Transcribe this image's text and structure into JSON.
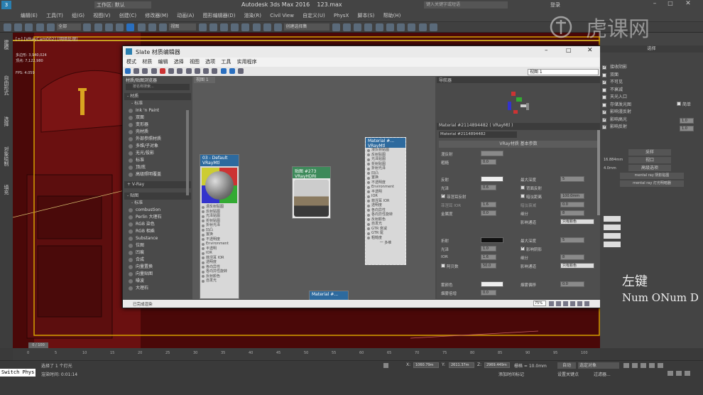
{
  "titlebar": {
    "workspace": "工作区: 默认",
    "app": "Autodesk 3ds Max 2016",
    "file": "123.max",
    "search_placeholder": "键入关键字或短语",
    "login": "登录"
  },
  "menu": [
    "编辑(E)",
    "工具(T)",
    "组(G)",
    "视图(V)",
    "创建(C)",
    "修改器(M)",
    "动画(A)",
    "图形编辑器(D)",
    "渲染(R)",
    "Civil View",
    "自定义(U)",
    "PhysX",
    "脚本(S)",
    "帮助(H)"
  ],
  "toolbar": {
    "filter": "全部",
    "view": "视图",
    "selset": "创建选择集"
  },
  "viewport": {
    "label": "[+] [VRayCam002] [明暗处理]",
    "stats": [
      "多边形: 3,940,024",
      "顶点: 7,122,980"
    ],
    "fps_label": "FPS:",
    "fps": "4.059"
  },
  "leftstrip": [
    "建模",
    "自由形式",
    "选择",
    "对象绘制",
    "填充"
  ],
  "slate": {
    "title": "Slate 材质编辑器",
    "menu": [
      "模式",
      "材质",
      "编辑",
      "选择",
      "视图",
      "选项",
      "工具",
      "实用程序"
    ],
    "view_select": "视图 1",
    "browser_title": "材质/贴图浏览器",
    "search_placeholder": "按名称搜索...",
    "sec_materials": "- 材质",
    "sub_standard": "- 标准",
    "materials": [
      "Ink 'n Paint",
      "双面",
      "变形器",
      "壳材质",
      "外部参照材质",
      "多维/子对象",
      "无光/投影",
      "标准",
      "顶/底",
      "高级照明覆盖"
    ],
    "sec_vray": "+ V-Ray",
    "sec_maps": "- 贴图",
    "sub_maps": "- 标准",
    "maps": [
      "combustion",
      "Perlin 大理石",
      "RGB 染色",
      "RGB 相乘",
      "Substance",
      "位图",
      "凹痕",
      "合成",
      "向量置换",
      "向量贴图",
      "噪波",
      "大理石"
    ],
    "view_tab": "视图 1",
    "status_left": "已完成渲染",
    "zoom": "75%",
    "navigator": "导航器",
    "node_std": {
      "title": "03 - Default",
      "type": "VRayMtl",
      "slots": [
        "漫反射贴图",
        "反射贴图",
        "光泽贴图",
        "折射贴图",
        "折射光泽",
        "凹凸",
        "置换",
        "不透明度",
        "Environment",
        "半透明",
        "IOR",
        "菲涅耳 IOR",
        "透明度",
        "各向异性",
        "各向异性旋转",
        "反射颜色",
        "自发光"
      ]
    },
    "node_bmp": {
      "title": "贴图 #273",
      "type": "VRayHDRI"
    },
    "node_right": {
      "title": "Material #...",
      "type": "VRayMtl",
      "slots": [
        "漫反射贴图",
        "反射贴图",
        "光泽贴图",
        "折射贴图",
        "折射光泽",
        "凹凸",
        "置换",
        "不透明度",
        "Environment",
        "半透明",
        "IOR",
        "菲涅耳 IOR",
        "透明度",
        "各向异性",
        "各向异性旋转",
        "反射颜色",
        "自发光",
        "GTR 衰减",
        "GTR 尾",
        "粗糙度"
      ],
      "footer": "一 多维"
    },
    "node_bottom": {
      "title": "Material #..."
    },
    "prop_header": "Material #2114894482 ( VRayMtl )",
    "prop_name": "Material #2114894482",
    "prop_rollout": "VRay材质 基本参数",
    "props": {
      "diffuse": "漫反射",
      "roughness": "粗糙",
      "roughness_val": "0.0",
      "reflect": "反射",
      "gloss": "光泽",
      "gloss_val": "0.6",
      "fresnel": "菲涅耳反射",
      "fresnel_ior": "菲涅耳 IOR",
      "fresnel_ior_val": "1.6",
      "metal": "金属度",
      "metal_val": "0.0",
      "maxdepth": "最大深度",
      "maxdepth_val": "5",
      "backside": "背面反射",
      "dim_dist": "暗淡距离",
      "dim_val": "100.0mm",
      "dim_falloff": "暗淡衰减",
      "dim_falloff_val": "0.0",
      "subdiv": "细分",
      "subdiv_val": "8",
      "affect": "影响通道",
      "affect_val": "只有颜色",
      "refract": "折射",
      "rgloss": "光泽",
      "rgloss_val": "1.0",
      "rior": "IOR",
      "rior_val": "1.6",
      "abbe": "阿贝数",
      "abbe_val": "50.0",
      "rmaxdepth": "最大深度",
      "rmaxdepth_val": "5",
      "affect_shadow": "影响阴影",
      "rsubdiv": "细分",
      "rsubdiv_val": "8",
      "raffect": "影响通道",
      "raffect_val": "只有颜色",
      "fog": "雾颜色",
      "fog_bias": "烟雾偏移",
      "fog_bias_val": "0.0",
      "fog_mult": "烟雾倍增",
      "fog_mult_val": "0.0"
    }
  },
  "rightpanel": {
    "header": "选择",
    "items": [
      {
        "label": "接收阴影",
        "on": true
      },
      {
        "label": "双面",
        "on": false
      },
      {
        "label": "不可见",
        "on": true
      },
      {
        "label": "不衰减",
        "on": false
      },
      {
        "label": "天光入口",
        "on": false
      },
      {
        "label": "存储发光图",
        "on": false
      },
      {
        "label": "影响漫反射",
        "on": true
      },
      {
        "label": "影响高光",
        "on": true
      },
      {
        "label": "影响反射",
        "on": true
      }
    ],
    "simple": "简单",
    "val1": "1.0",
    "val2": "1.0",
    "val3": "1.0",
    "btn_sample": "采样",
    "btn_viewport": "视口",
    "btn_adv": "高级选项",
    "btn_mr_shadow": "mental ray 阴影贴图",
    "btn_mr_lights": "mental ray 灯光明暗器",
    "dist": "16.884mm",
    "dist2": "4.0mm"
  },
  "overlay": {
    "line1": "左键",
    "line2": "Num ONum D"
  },
  "watermark": "虎课网",
  "timeline": {
    "frame": "0 / 100",
    "ticks": [
      "0",
      "5",
      "10",
      "15",
      "20",
      "25",
      "30",
      "35",
      "40",
      "45",
      "50",
      "55",
      "60",
      "65",
      "70",
      "75",
      "80",
      "85",
      "90",
      "95",
      "100"
    ]
  },
  "status": {
    "switch": "Switch Phys",
    "msg1": "选择了 1 个灯光",
    "msg2": "渲染时间: 0:01:14",
    "x_label": "X:",
    "x": "1060.79m",
    "y_label": "Y:",
    "y": "2611.37m",
    "z_label": "Z:",
    "z": "2969.449m",
    "grid": "栅格 = 10.0mm",
    "auto": "自动",
    "setkey": "设置关键点",
    "filter": "过滤器...",
    "selobj": "选定对象",
    "addtime": "添加时间标记"
  }
}
